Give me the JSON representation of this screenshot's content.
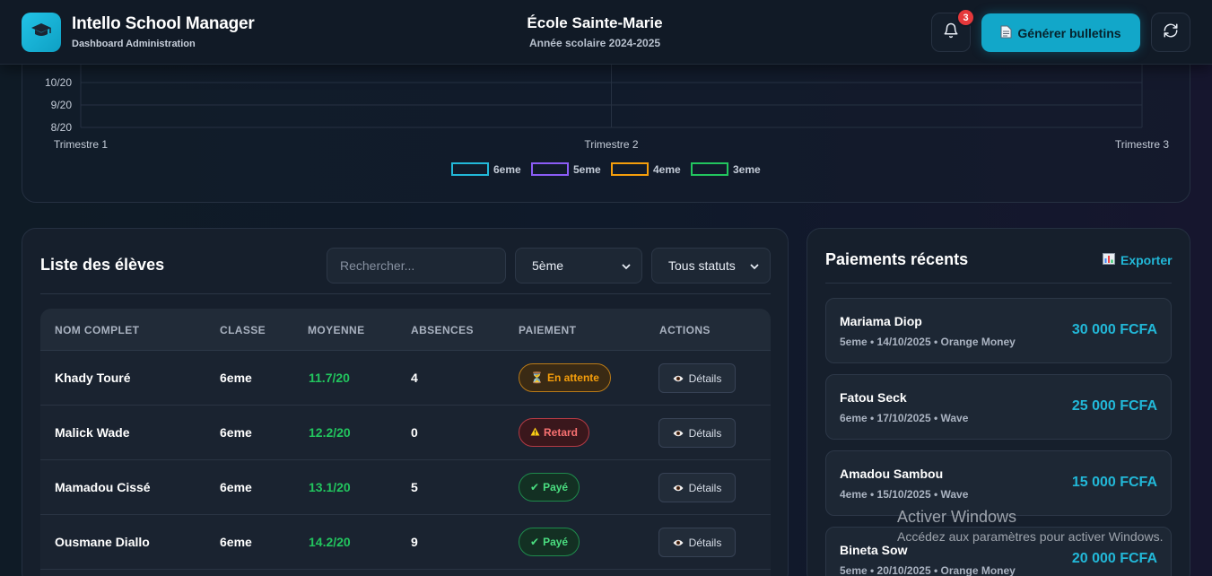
{
  "header": {
    "app_title": "Intello School Manager",
    "app_subtitle": "Dashboard Administration",
    "school_name": "École Sainte-Marie",
    "school_year": "Année scolaire 2024-2025",
    "notification_count": "3",
    "generate_label": "Générer bulletins",
    "icons": {
      "logo": "graduation-cap-icon",
      "bell": "bell-icon",
      "generate": "document-icon",
      "refresh": "refresh-icon"
    }
  },
  "chart_data": {
    "type": "line",
    "x": [
      "Trimestre 1",
      "Trimestre 2",
      "Trimestre 3"
    ],
    "y_ticks_visible": [
      "10/20",
      "9/20",
      "8/20"
    ],
    "y_ticks_values": [
      10,
      9,
      8
    ],
    "series": [
      {
        "name": "6eme",
        "color": "#22b8d8"
      },
      {
        "name": "5eme",
        "color": "#8b5cf6"
      },
      {
        "name": "4eme",
        "color": "#f59e0b"
      },
      {
        "name": "3eme",
        "color": "#22c55e"
      }
    ],
    "grid": true,
    "legend": "bottom-center"
  },
  "students": {
    "title": "Liste des élèves",
    "search_placeholder": "Rechercher...",
    "class_filter": "5ème",
    "status_filter": "Tous statuts",
    "columns": [
      "NOM COMPLET",
      "CLASSE",
      "MOYENNE",
      "ABSENCES",
      "PAIEMENT",
      "ACTIONS"
    ],
    "details_label": "Détails",
    "rows": [
      {
        "name": "Khady Touré",
        "class": "6eme",
        "average": "11.7/20",
        "absences": "4",
        "payment": "En attente",
        "payment_status": "pending",
        "payment_icon": "⏳"
      },
      {
        "name": "Malick Wade",
        "class": "6eme",
        "average": "12.2/20",
        "absences": "0",
        "payment": "Retard",
        "payment_status": "late",
        "payment_icon": "⚠"
      },
      {
        "name": "Mamadou Cissé",
        "class": "6eme",
        "average": "13.1/20",
        "absences": "5",
        "payment": "Payé",
        "payment_status": "paid",
        "payment_icon": "✔"
      },
      {
        "name": "Ousmane Diallo",
        "class": "6eme",
        "average": "14.2/20",
        "absences": "9",
        "payment": "Payé",
        "payment_status": "paid",
        "payment_icon": "✔"
      }
    ]
  },
  "payments": {
    "title": "Paiements récents",
    "export_label": "Exporter",
    "items": [
      {
        "name": "Mariama Diop",
        "meta": "5eme • 14/10/2025 • Orange Money",
        "amount": "30 000 FCFA"
      },
      {
        "name": "Fatou Seck",
        "meta": "6eme • 17/10/2025 • Wave",
        "amount": "25 000 FCFA"
      },
      {
        "name": "Amadou Sambou",
        "meta": "4eme • 15/10/2025 • Wave",
        "amount": "15 000 FCFA"
      },
      {
        "name": "Bineta Sow",
        "meta": "5eme • 20/10/2025 • Orange Money",
        "amount": "20 000 FCFA"
      }
    ]
  },
  "watermark": {
    "title": "Activer Windows",
    "subtitle": "Accédez aux paramètres pour activer Windows."
  }
}
